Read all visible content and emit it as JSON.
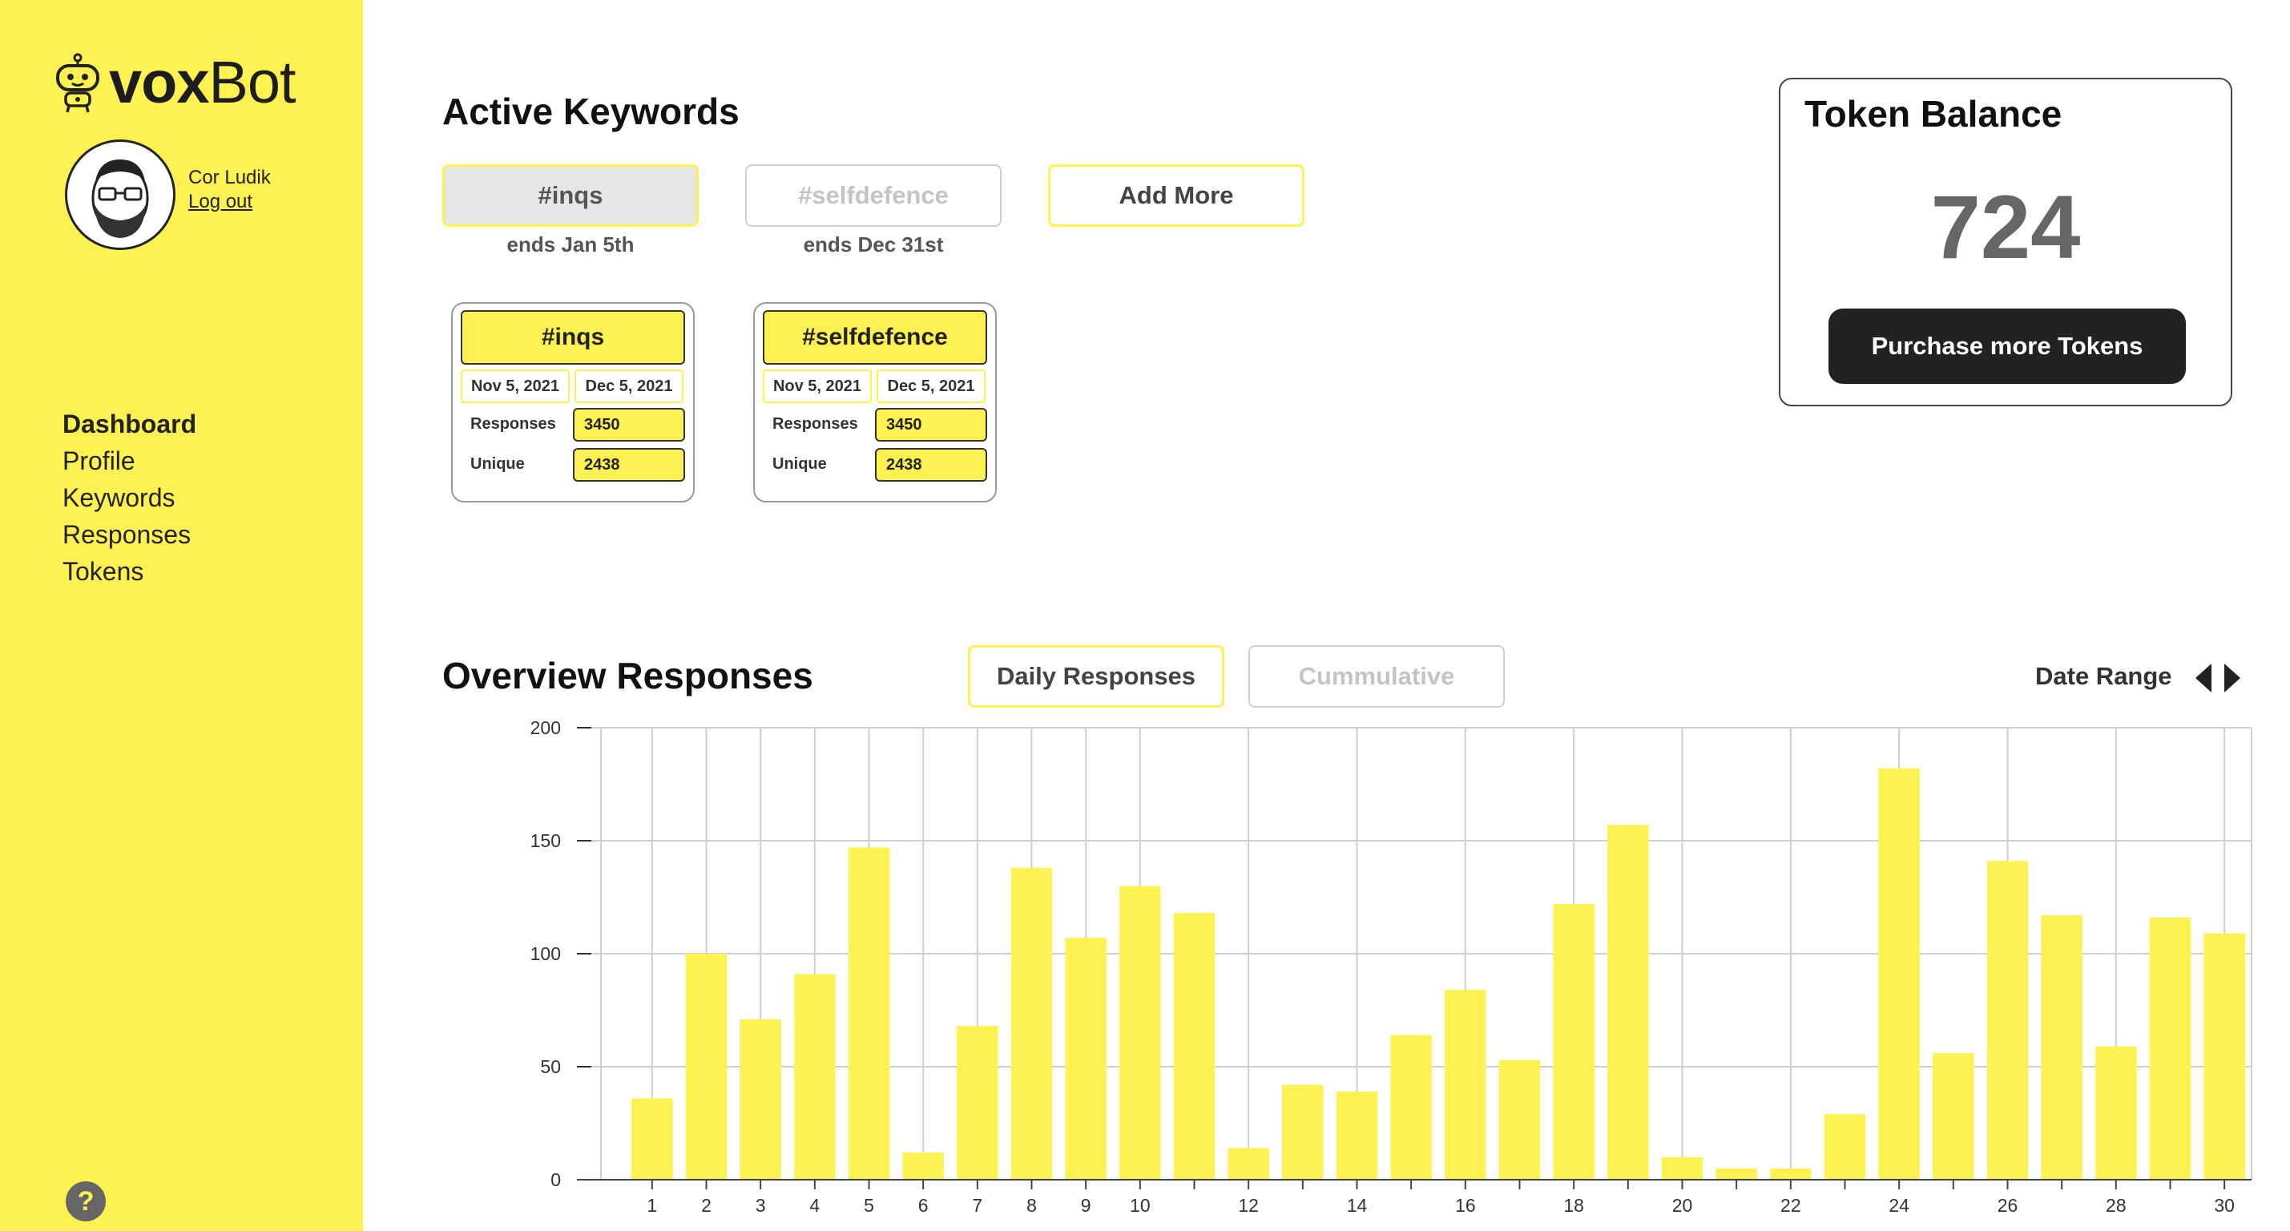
{
  "brand": {
    "name_bold": "vox",
    "name_light": "Bot"
  },
  "user": {
    "name": "Cor Ludik",
    "logout_label": "Log out"
  },
  "nav": {
    "items": [
      "Dashboard",
      "Profile",
      "Keywords",
      "Responses",
      "Tokens"
    ],
    "active": "Dashboard"
  },
  "help": {
    "label": "?"
  },
  "active_keywords": {
    "title": "Active Keywords",
    "buttons": [
      {
        "label": "#inqs",
        "ends": "ends Jan 5th"
      },
      {
        "label": "#selfdefence",
        "ends": "ends Dec 31st"
      },
      {
        "label": "Add More"
      }
    ],
    "cards": [
      {
        "title": "#inqs",
        "start": "Nov 5, 2021",
        "end": "Dec 5, 2021",
        "responses_label": "Responses",
        "responses": "3450",
        "unique_label": "Unique",
        "unique": "2438"
      },
      {
        "title": "#selfdefence",
        "start": "Nov 5, 2021",
        "end": "Dec 5, 2021",
        "responses_label": "Responses",
        "responses": "3450",
        "unique_label": "Unique",
        "unique": "2438"
      }
    ]
  },
  "token_balance": {
    "title": "Token Balance",
    "value": "724",
    "button_label": "Purchase more Tokens"
  },
  "overview": {
    "title": "Overview Responses",
    "tabs": [
      "Daily Responses",
      "Cummulative"
    ],
    "active_tab": "Daily Responses",
    "date_range_label": "Date Range"
  },
  "colors": {
    "accent": "#fdf251",
    "bar": "#fdf251",
    "dark": "#222222"
  },
  "chart_data": {
    "type": "bar",
    "categories": [
      "1",
      "2",
      "3",
      "4",
      "5",
      "6",
      "7",
      "8",
      "9",
      "10",
      "11",
      "12",
      "13",
      "14",
      "15",
      "16",
      "17",
      "18",
      "19",
      "20",
      "21",
      "22",
      "23",
      "24",
      "25",
      "26",
      "27",
      "28",
      "29",
      "30"
    ],
    "x_tick_labels": [
      "1",
      "2",
      "3",
      "4",
      "5",
      "6",
      "7",
      "8",
      "9",
      "10",
      "",
      "12",
      "",
      "14",
      "",
      "16",
      "",
      "18",
      "",
      "20",
      "",
      "22",
      "",
      "24",
      "",
      "26",
      "",
      "28",
      "",
      "30"
    ],
    "values": [
      36,
      100,
      71,
      91,
      147,
      12,
      68,
      138,
      107,
      130,
      118,
      14,
      42,
      39,
      64,
      84,
      53,
      122,
      157,
      10,
      5,
      5,
      29,
      182,
      56,
      141,
      117,
      59,
      116,
      109
    ],
    "ylim": [
      0,
      200
    ],
    "yticks": [
      0,
      50,
      100,
      150,
      200
    ],
    "grid": true,
    "title": "",
    "xlabel": "",
    "ylabel": ""
  }
}
